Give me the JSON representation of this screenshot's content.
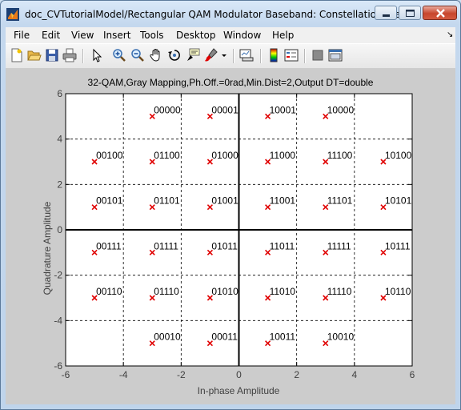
{
  "window": {
    "title": "doc_CVTutorialModel/Rectangular QAM Modulator Baseband: Constellation View",
    "controls": [
      "minimize",
      "maximize",
      "close"
    ]
  },
  "menu": [
    "File",
    "Edit",
    "View",
    "Insert",
    "Tools",
    "Desktop",
    "Window",
    "Help"
  ],
  "toolbar": [
    "new-figure-icon",
    "open-file-icon",
    "save-icon",
    "print-icon",
    "pointer-icon",
    "zoom-in-icon",
    "zoom-out-icon",
    "pan-hand-icon",
    "rotate-3d-icon",
    "data-cursor-icon",
    "brush-icon",
    "brush-dropdown-icon",
    "link-plot-icon",
    "colorbar-icon",
    "legend-icon",
    "hide-plot-tools-icon",
    "show-plot-tools-icon"
  ],
  "chart_data": {
    "type": "scatter",
    "title": "32-QAM,Gray Mapping,Ph.Off.=0rad,Min.Dist=2,Output DT=double",
    "xlabel": "In-phase Amplitude",
    "ylabel": "Quadrature Amplitude",
    "xlim": [
      -6,
      6
    ],
    "ylim": [
      -6,
      6
    ],
    "xticks": [
      "-6",
      "-4",
      "-2",
      "0",
      "2",
      "4",
      "6"
    ],
    "yticks": [
      "-6",
      "-4",
      "-2",
      "0",
      "2",
      "4",
      "6"
    ],
    "grid": true,
    "marker": "x",
    "marker_color": "#e00000",
    "points": [
      {
        "x": -3,
        "y": 5,
        "label": "00000"
      },
      {
        "x": -1,
        "y": 5,
        "label": "00001"
      },
      {
        "x": 1,
        "y": 5,
        "label": "10001"
      },
      {
        "x": 3,
        "y": 5,
        "label": "10000"
      },
      {
        "x": -5,
        "y": 3,
        "label": "00100"
      },
      {
        "x": -3,
        "y": 3,
        "label": "01100"
      },
      {
        "x": -1,
        "y": 3,
        "label": "01000"
      },
      {
        "x": 1,
        "y": 3,
        "label": "11000"
      },
      {
        "x": 3,
        "y": 3,
        "label": "11100"
      },
      {
        "x": 5,
        "y": 3,
        "label": "10100"
      },
      {
        "x": -5,
        "y": 1,
        "label": "00101"
      },
      {
        "x": -3,
        "y": 1,
        "label": "01101"
      },
      {
        "x": -1,
        "y": 1,
        "label": "01001"
      },
      {
        "x": 1,
        "y": 1,
        "label": "11001"
      },
      {
        "x": 3,
        "y": 1,
        "label": "11101"
      },
      {
        "x": 5,
        "y": 1,
        "label": "10101"
      },
      {
        "x": -5,
        "y": -1,
        "label": "00111"
      },
      {
        "x": -3,
        "y": -1,
        "label": "01111"
      },
      {
        "x": -1,
        "y": -1,
        "label": "01011"
      },
      {
        "x": 1,
        "y": -1,
        "label": "11011"
      },
      {
        "x": 3,
        "y": -1,
        "label": "11111"
      },
      {
        "x": 5,
        "y": -1,
        "label": "10111"
      },
      {
        "x": -5,
        "y": -3,
        "label": "00110"
      },
      {
        "x": -3,
        "y": -3,
        "label": "01110"
      },
      {
        "x": -1,
        "y": -3,
        "label": "01010"
      },
      {
        "x": 1,
        "y": -3,
        "label": "11010"
      },
      {
        "x": 3,
        "y": -3,
        "label": "11110"
      },
      {
        "x": 5,
        "y": -3,
        "label": "10110"
      },
      {
        "x": -3,
        "y": -5,
        "label": "00010"
      },
      {
        "x": -1,
        "y": -5,
        "label": "00011"
      },
      {
        "x": 1,
        "y": -5,
        "label": "10011"
      },
      {
        "x": 3,
        "y": -5,
        "label": "10010"
      }
    ]
  }
}
